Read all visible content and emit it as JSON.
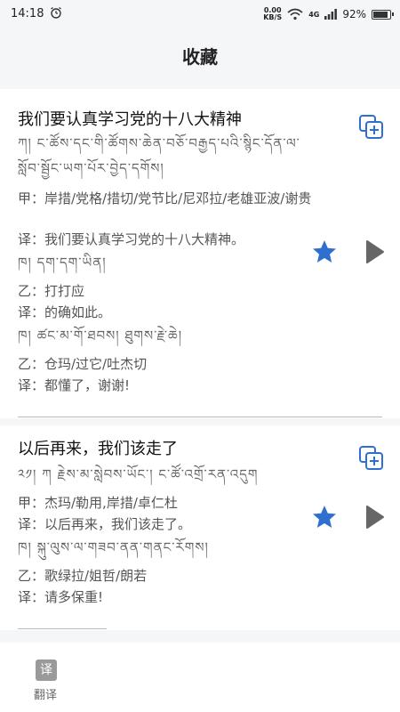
{
  "status": {
    "time": "14:18",
    "speed_value": "0.00",
    "speed_unit": "KB/S",
    "network": "4G",
    "battery": "92%",
    "battery_level": 0.92
  },
  "header": {
    "title": "收藏"
  },
  "cards": [
    {
      "title": "我们要认真学习党的十八大精神",
      "tib1": "ཀ།  ང་ཚོས་དང་གི་ཚོགས་ཆེན་བཅོ་བརྒྱད་པའི་སྙིང་དོན་ལ་",
      "tib2": "སློབ་སྦྱོང་ཡག་པོར་བྱེད་དགོས།",
      "speaker_a": "甲：岸措/党格/措切/党节比/尼邓拉/老雄亚波/谢贵",
      "translation_a": "译：我们要认真学习党的十八大精神。",
      "tib3": "ཁ།  དག་དག་ཡིན།",
      "speaker_b": "乙：打打应",
      "translation_b": "译：的确如此。",
      "tib4": "ཁ།  ཚང་མ་གོ་ཐབས།  ཐུགས་རྗེ་ཆེ།",
      "speaker_c": "乙：仓玛/过它/吐杰切",
      "translation_c": "译：都懂了，谢谢!"
    },
    {
      "title": "以后再来，我们该走了",
      "tib1": "༢༡། ཀ  རྗེས་མ་སླེབས་ཡོང་།        ང་ཚོ་འགྲོ་རན་འདུག",
      "speaker_a": "甲：杰玛/勒用,岸措/卓仁杜",
      "translation_a": "译：以后再来，我们该走了。",
      "tib2": "ཁ།  སྐུ་ལུས་ལ་གཟབ་ནན་གནང་རོགས།",
      "speaker_b": "乙：歌绿拉/姐哲/朗若",
      "translation_b": "译：请多保重!"
    }
  ],
  "bottom_nav": {
    "tab_icon_glyph": "译",
    "tab_label": "翻译"
  },
  "colors": {
    "accent_blue": "#2f6fd0",
    "play_grey": "#666666",
    "background": "#f5f6f8"
  }
}
